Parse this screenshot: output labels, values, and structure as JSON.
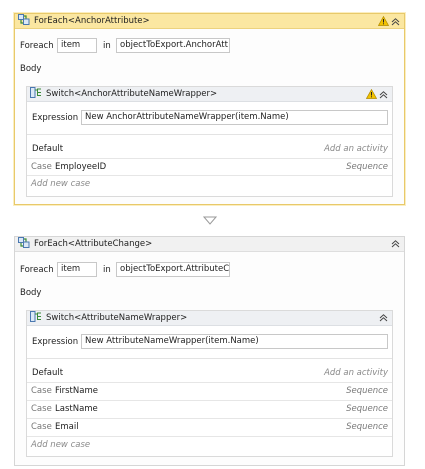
{
  "activities": [
    {
      "title": "ForEach<AnchorAttribute>",
      "foreach_label": "Foreach",
      "item_value": "item",
      "in_label": "in",
      "collection_value": "objectToExport.AnchorAtt",
      "body_label": "Body",
      "switch": {
        "title": "Switch<AnchorAttributeNameWrapper>",
        "expression_label": "Expression",
        "expression_value": "New AnchorAttributeNameWrapper(item.Name)",
        "default_label": "Default",
        "add_activity": "Add an activity",
        "cases": [
          {
            "kw": "Case",
            "name": "EmployeeID",
            "body": "Sequence"
          }
        ],
        "add_case": "Add new case"
      }
    },
    {
      "title": "ForEach<AttributeChange>",
      "foreach_label": "Foreach",
      "item_value": "item",
      "in_label": "in",
      "collection_value": "objectToExport.AttributeC",
      "body_label": "Body",
      "switch": {
        "title": "Switch<AttributeNameWrapper>",
        "expression_label": "Expression",
        "expression_value": "New AttributeNameWrapper(item.Name)",
        "default_label": "Default",
        "add_activity": "Add an activity",
        "cases": [
          {
            "kw": "Case",
            "name": "FirstName",
            "body": "Sequence"
          },
          {
            "kw": "Case",
            "name": "LastName",
            "body": "Sequence"
          },
          {
            "kw": "Case",
            "name": "Email",
            "body": "Sequence"
          }
        ],
        "add_case": "Add new case"
      }
    }
  ],
  "icons": {
    "foreach": "foreach-activity-icon",
    "switch": "switch-activity-icon",
    "warning": "warning-icon",
    "collapse": "collapse-chevron-up-icon",
    "connector": "connector-arrow-down-icon"
  },
  "colors": {
    "selected_header": "#fbe7a1",
    "selected_border": "#e8c96a",
    "warning": "#f2c200"
  }
}
